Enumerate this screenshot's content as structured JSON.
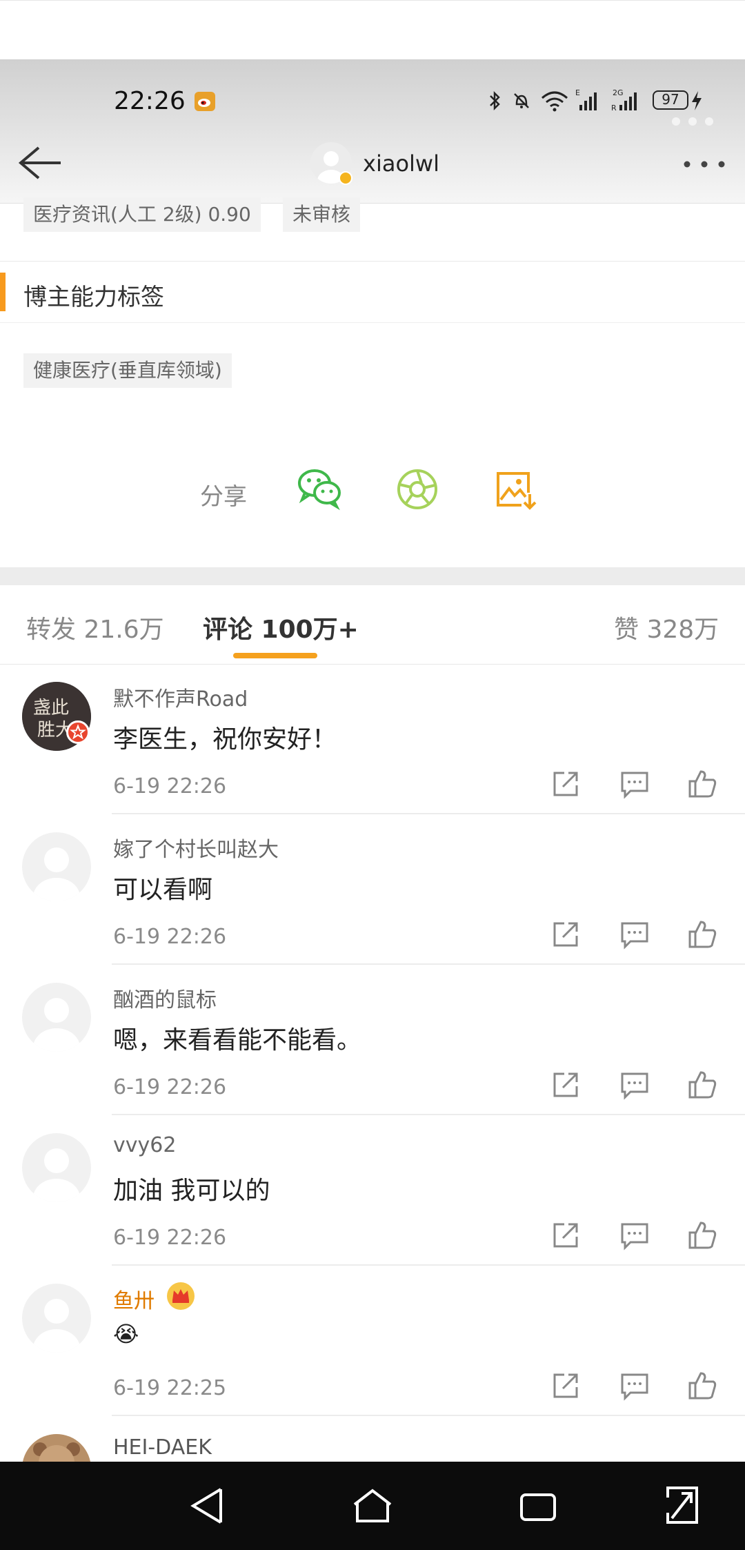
{
  "status_bar": {
    "time": "22:26",
    "battery": "97",
    "signal_labels": [
      "E",
      "2G"
    ]
  },
  "nav": {
    "username": "xiaolwl",
    "back_icon": "back-arrow-icon",
    "more_icon": "more-dots-icon"
  },
  "tags_top": [
    "医疗资讯(人工 2级) 0.90",
    "未审核"
  ],
  "section": {
    "title": "博主能力标签",
    "tags": [
      "健康医疗(垂直库领域)"
    ]
  },
  "share": {
    "label": "分享",
    "icons": [
      "wechat-icon",
      "moments-icon",
      "save-image-icon"
    ]
  },
  "tabs": {
    "repost": "转发 21.6万",
    "comment": "评论 100万+",
    "like": "赞 328万"
  },
  "comments": [
    {
      "name": "默不作声Road",
      "text": "李医生，祝你安好！",
      "time": "6-19 22:26"
    },
    {
      "name": "嫁了个村长叫赵大",
      "text": "可以看啊",
      "time": "6-19 22:26"
    },
    {
      "name": "酗酒的鼠标",
      "text": "嗯，来看看能不能看。",
      "time": "6-19 22:26"
    },
    {
      "name": "vvy62",
      "text": "加油 我可以的",
      "time": "6-19 22:26"
    },
    {
      "name": "鱼卅",
      "text": "😭",
      "time": "6-19 22:25"
    },
    {
      "name": "HEI-DAEK",
      "text": "",
      "time": ""
    }
  ],
  "colors": {
    "accent": "#f5a11e",
    "vip_name": "#e07b00",
    "wechat_green": "#3fb84a",
    "moments_green": "#a6d25b",
    "save_orange": "#f0a21c"
  },
  "bottom_nav": [
    "back-triangle-icon",
    "home-icon",
    "recents-icon",
    "expand-icon"
  ]
}
